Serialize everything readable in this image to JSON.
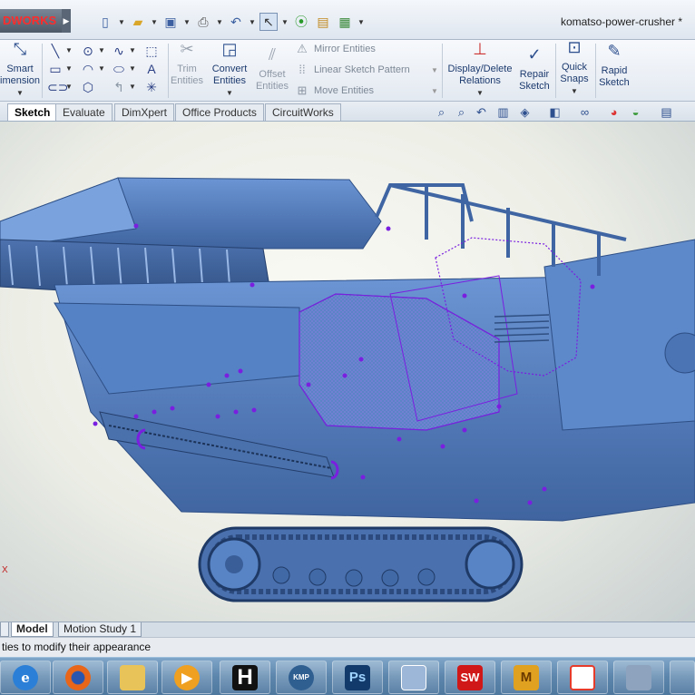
{
  "app": {
    "brand_prefix": "",
    "brand_suffix": "DWORKS",
    "document_title": "komatso-power-crusher *"
  },
  "quick_access": [
    "new-document-icon",
    "open-folder-icon",
    "save-icon",
    "print-icon",
    "undo-icon",
    "select-arrow-icon",
    "rebuild-traffic-light-icon",
    "file-properties-icon",
    "options-icon"
  ],
  "ribbon": {
    "smart_dimension": {
      "line1": "Smart",
      "line2": "imension"
    },
    "trim": {
      "line1": "Trim",
      "line2": "Entities"
    },
    "convert": {
      "line1": "Convert",
      "line2": "Entities"
    },
    "offset": {
      "line1": "Offset",
      "line2": "Entities"
    },
    "mirror": "Mirror Entities",
    "linear_pattern": "Linear Sketch Pattern",
    "move": "Move Entities",
    "display_delete": {
      "line1": "Display/Delete",
      "line2": "Relations"
    },
    "repair": {
      "line1": "Repair",
      "line2": "Sketch"
    },
    "quick_snaps": {
      "line1": "Quick",
      "line2": "Snaps"
    },
    "rapid_sketch": {
      "line1": "Rapid",
      "line2": "Sketch"
    }
  },
  "tabs": [
    {
      "label": "Sketch",
      "active": true
    },
    {
      "label": "Evaluate",
      "active": false
    },
    {
      "label": "DimXpert",
      "active": false
    },
    {
      "label": "Office Products",
      "active": false
    },
    {
      "label": "CircuitWorks",
      "active": false
    }
  ],
  "view_tools": [
    "zoom-to-fit-icon",
    "zoom-to-area-icon",
    "previous-view-icon",
    "section-view-icon",
    "view-orientation-icon",
    "display-style-icon",
    "hide-show-items-icon",
    "edit-appearance-icon",
    "apply-scene-icon",
    "view-settings-icon"
  ],
  "viewport": {
    "model_color": "#5b86c8",
    "sketch_color": "#7a1fe0",
    "triad_x": "X"
  },
  "model_tabs": [
    {
      "label": "Model",
      "active": true
    },
    {
      "label": "Motion Study 1",
      "active": false
    }
  ],
  "status": {
    "text": "ties to modify their appearance"
  },
  "taskbar": [
    {
      "name": "internet-explorer-icon",
      "label": "e",
      "color": "#2c7fd6"
    },
    {
      "name": "firefox-icon",
      "label": "",
      "color": "#e8661a"
    },
    {
      "name": "file-explorer-icon",
      "label": "",
      "color": "#e8c35a"
    },
    {
      "name": "media-player-icon",
      "label": "▶",
      "color": "#f0a020"
    },
    {
      "name": "h-app-icon",
      "label": "H",
      "color": "#111111"
    },
    {
      "name": "kmplayer-icon",
      "label": "KMP",
      "color": "#2f5e91"
    },
    {
      "name": "photoshop-icon",
      "label": "Ps",
      "color": "#123a6b"
    },
    {
      "name": "document-viewer-icon",
      "label": "",
      "color": "#9cb7d8"
    },
    {
      "name": "solidworks-icon",
      "label": "SW",
      "color": "#d01818"
    },
    {
      "name": "autodesk-icon",
      "label": "M",
      "color": "#e0a020"
    },
    {
      "name": "acrobat-icon",
      "label": "",
      "color": "#e63a2a"
    },
    {
      "name": "drafting-icon",
      "label": "",
      "color": "#8ea4be"
    }
  ]
}
